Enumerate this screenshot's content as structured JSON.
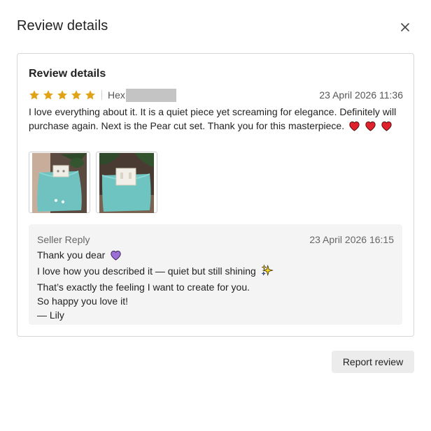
{
  "modal": {
    "title": "Review details",
    "close_label": "×"
  },
  "review": {
    "card_title": "Review details",
    "rating": 5,
    "rating_max": 5,
    "star_color": "#e0a316",
    "reviewer_name": "Hex",
    "date": "23 April 2026 11:36",
    "text": "I love everything about it. It is a quiet piece yet screaming for elegance. Definitely will purchase again. Next is the Pear cut set. Thank you for this masterpiece.",
    "photos": [
      {
        "icon": "jewelry-pouch-photo-1"
      },
      {
        "icon": "jewelry-pouch-photo-2"
      }
    ]
  },
  "seller_reply": {
    "label": "Seller Reply",
    "date": "23 April 2026 16:15",
    "lines": [
      "Thank you dear",
      "I love how you described it — quiet but still shining",
      "That’s exactly the feeling I want to create for you.",
      "So happy you love it!",
      "— Lily"
    ]
  },
  "actions": {
    "report_label": "Report review"
  }
}
